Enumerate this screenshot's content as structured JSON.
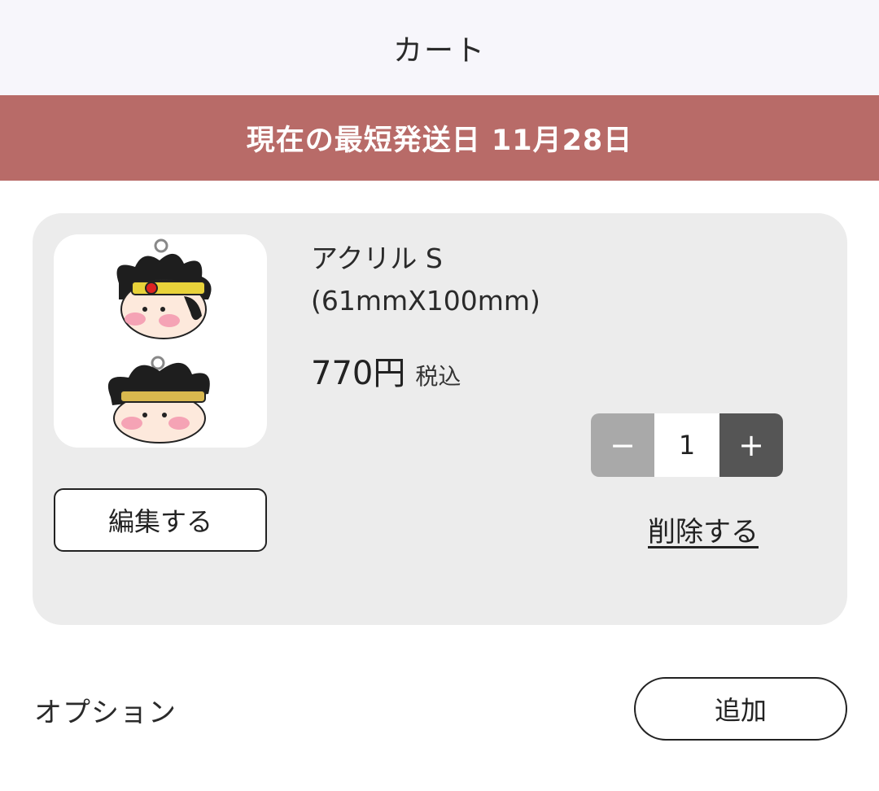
{
  "header": {
    "title": "カート"
  },
  "banner": {
    "text": "現在の最短発送日 11月28日"
  },
  "cart_item": {
    "name_line1": "アクリル S",
    "name_line2": "(61mmX100mm)",
    "price": "770円",
    "tax_label": "税込",
    "quantity": "1",
    "minus_label": "−",
    "plus_label": "+",
    "edit_label": "編集する",
    "delete_label": "削除する",
    "thumbnail_icon": "acrylic-keychain-thumbnail"
  },
  "options": {
    "label": "オプション",
    "add_label": "追加"
  },
  "colors": {
    "banner": "#b86b68",
    "card": "#ececec",
    "minus_button": "#a9a9a9",
    "plus_button": "#555555"
  }
}
